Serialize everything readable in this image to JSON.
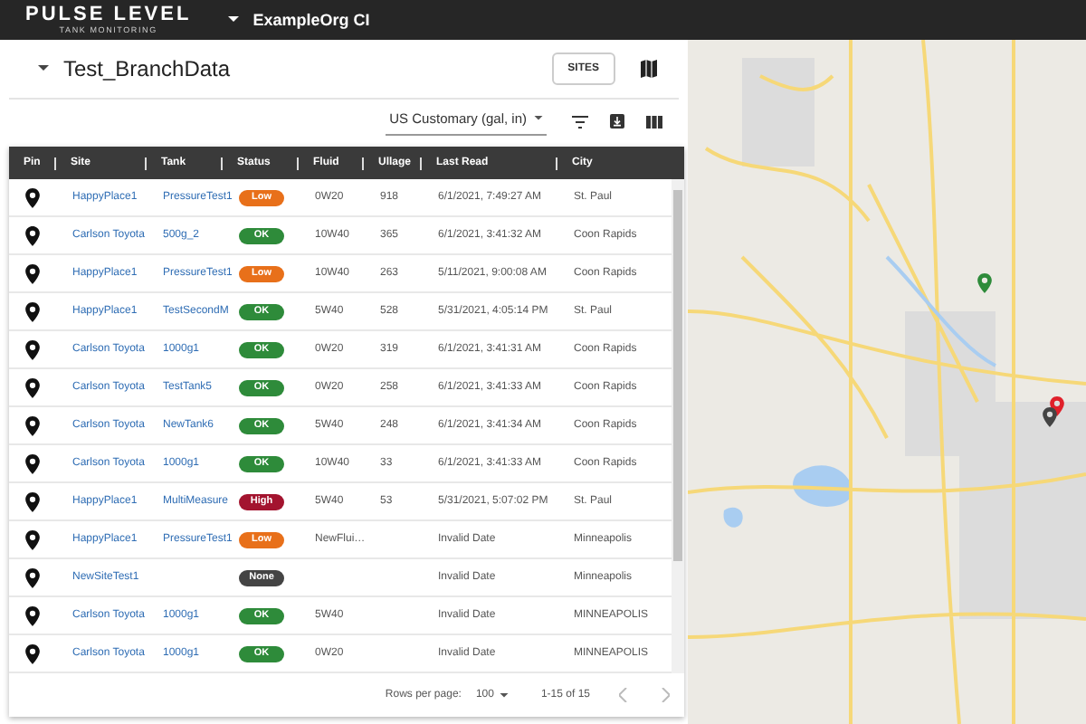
{
  "header": {
    "brand": "PULSE LEVEL",
    "tagline": "TANK MONITORING",
    "org": "ExampleOrg CI"
  },
  "panel": {
    "title": "Test_BranchData",
    "sites_button": "SITES",
    "units": "US Customary (gal, in)"
  },
  "table": {
    "columns": [
      "Pin",
      "Site",
      "Tank",
      "Status",
      "Fluid",
      "Ullage",
      "Last Read",
      "City"
    ],
    "rows": [
      {
        "site": "HappyPlace1",
        "tank": "PressureTest1",
        "status": "Low",
        "color": "#e8701a",
        "fluid": "0W20",
        "ullage": "918",
        "last_read": "6/1/2021, 7:49:27 AM",
        "city": "St. Paul"
      },
      {
        "site": "Carlson Toyota",
        "tank": "500g_2",
        "status": "OK",
        "color": "#2e8b3a",
        "fluid": "10W40",
        "ullage": "365",
        "last_read": "6/1/2021, 3:41:32 AM",
        "city": "Coon Rapids"
      },
      {
        "site": "HappyPlace1",
        "tank": "PressureTest1",
        "status": "Low",
        "color": "#e8701a",
        "fluid": "10W40",
        "ullage": "263",
        "last_read": "5/11/2021, 9:00:08 AM",
        "city": "Coon Rapids"
      },
      {
        "site": "HappyPlace1",
        "tank": "TestSecondM",
        "status": "OK",
        "color": "#2e8b3a",
        "fluid": "5W40",
        "ullage": "528",
        "last_read": "5/31/2021, 4:05:14 PM",
        "city": "St. Paul"
      },
      {
        "site": "Carlson Toyota",
        "tank": "1000g1",
        "status": "OK",
        "color": "#2e8b3a",
        "fluid": "0W20",
        "ullage": "319",
        "last_read": "6/1/2021, 3:41:31 AM",
        "city": "Coon Rapids"
      },
      {
        "site": "Carlson Toyota",
        "tank": "TestTank5",
        "status": "OK",
        "color": "#2e8b3a",
        "fluid": "0W20",
        "ullage": "258",
        "last_read": "6/1/2021, 3:41:33 AM",
        "city": "Coon Rapids"
      },
      {
        "site": "Carlson Toyota",
        "tank": "NewTank6",
        "status": "OK",
        "color": "#2e8b3a",
        "fluid": "5W40",
        "ullage": "248",
        "last_read": "6/1/2021, 3:41:34 AM",
        "city": "Coon Rapids"
      },
      {
        "site": "Carlson Toyota",
        "tank": "1000g1",
        "status": "OK",
        "color": "#2e8b3a",
        "fluid": "10W40",
        "ullage": "33",
        "last_read": "6/1/2021, 3:41:33 AM",
        "city": "Coon Rapids"
      },
      {
        "site": "HappyPlace1",
        "tank": "MultiMeasure",
        "status": "High",
        "color": "#a3142f",
        "fluid": "5W40",
        "ullage": "53",
        "last_read": "5/31/2021, 5:07:02 PM",
        "city": "St. Paul"
      },
      {
        "site": "HappyPlace1",
        "tank": "PressureTest1",
        "status": "Low",
        "color": "#e8701a",
        "fluid": "NewFlui…",
        "last_read": "Invalid Date",
        "city": "Minneapolis"
      },
      {
        "site": "NewSiteTest1",
        "status": "None",
        "color": "#444444",
        "last_read": "Invalid Date",
        "city": "Minneapolis"
      },
      {
        "site": "Carlson Toyota",
        "tank": "1000g1",
        "status": "OK",
        "color": "#2e8b3a",
        "fluid": "5W40",
        "last_read": "Invalid Date",
        "city": "MINNEAPOLIS"
      },
      {
        "site": "Carlson Toyota",
        "tank": "1000g1",
        "status": "OK",
        "color": "#2e8b3a",
        "fluid": "0W20",
        "last_read": "Invalid Date",
        "city": "MINNEAPOLIS"
      }
    ]
  },
  "pagination": {
    "rows_per_page_label": "Rows per page:",
    "rows_per_page": "100",
    "range": "1-15 of 15"
  }
}
